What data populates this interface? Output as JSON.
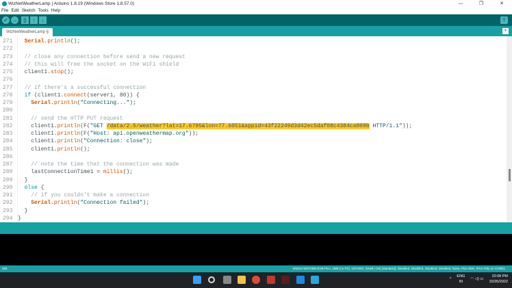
{
  "window": {
    "title": "WizNetWeatherLamp | Arduino 1.8.19 (Windows Store 1.8.57.0)",
    "controls": [
      "—",
      "❐",
      "✕"
    ]
  },
  "menu": [
    "File",
    "Edit",
    "Sketch",
    "Tools",
    "Help"
  ],
  "toolbar": {
    "verify": "✓",
    "upload": "→",
    "new": "▯",
    "open": "↑",
    "save": "↓",
    "serial_monitor": "⚲"
  },
  "tab": {
    "label": "WizNetWeatherLamp §",
    "menu": "▾"
  },
  "code": [
    {
      "n": "271",
      "s": [
        [
          "  ",
          ""
        ],
        [
          "Serial",
          "cl"
        ],
        [
          ".",
          ""
        ],
        [
          "println",
          "fn"
        ],
        [
          "();",
          ""
        ]
      ]
    },
    {
      "n": "272",
      "s": []
    },
    {
      "n": "273",
      "s": [
        [
          "  // close any connection before send a new request",
          "cm"
        ]
      ]
    },
    {
      "n": "274",
      "s": [
        [
          "  // this will free the socket on the WiFi shield",
          "cm"
        ]
      ]
    },
    {
      "n": "275",
      "s": [
        [
          "  client1.",
          ""
        ],
        [
          "stop",
          "fn"
        ],
        [
          "();",
          ""
        ]
      ]
    },
    {
      "n": "276",
      "s": []
    },
    {
      "n": "277",
      "s": [
        [
          "  // if there's a successful connection",
          "cm"
        ]
      ]
    },
    {
      "n": "278",
      "s": [
        [
          "  ",
          ""
        ],
        [
          "if",
          "kw"
        ],
        [
          " (client1.",
          ""
        ],
        [
          "connect",
          "fn"
        ],
        [
          "(server1, 80)) {",
          ""
        ]
      ]
    },
    {
      "n": "279",
      "s": [
        [
          "    ",
          ""
        ],
        [
          "Serial",
          "cl"
        ],
        [
          ".",
          ""
        ],
        [
          "println",
          "fn"
        ],
        [
          "(",
          ""
        ],
        [
          "\"Connecting...\"",
          "st"
        ],
        [
          ");",
          ""
        ]
      ]
    },
    {
      "n": "280",
      "s": []
    },
    {
      "n": "281",
      "s": [
        [
          "    // send the HTTP PUT request",
          "cm"
        ]
      ]
    },
    {
      "n": "282",
      "s": [
        [
          "    client1.",
          ""
        ],
        [
          "println",
          "fn"
        ],
        [
          "(F(",
          ""
        ],
        [
          "\"GET ",
          "st"
        ],
        [
          "/data/2.5/weather?lat=17.6795&lon=77.6051&appid=43f22249d3d42ec5daf08c4384ca809b",
          "hl"
        ],
        [
          " HTTP/1.1\"",
          "st"
        ],
        [
          "));",
          ""
        ]
      ]
    },
    {
      "n": "283",
      "s": [
        [
          "    client1.",
          ""
        ],
        [
          "println",
          "fn"
        ],
        [
          "(F(",
          ""
        ],
        [
          "\"Host: api.openweathermap.org\"",
          "st"
        ],
        [
          "));",
          ""
        ]
      ]
    },
    {
      "n": "284",
      "s": [
        [
          "    client1.",
          ""
        ],
        [
          "println",
          "fn"
        ],
        [
          "(",
          ""
        ],
        [
          "\"Connection: close\"",
          "st"
        ],
        [
          ");",
          ""
        ]
      ]
    },
    {
      "n": "285",
      "s": [
        [
          "    client1.",
          ""
        ],
        [
          "println",
          "fn"
        ],
        [
          "();",
          ""
        ]
      ]
    },
    {
      "n": "286",
      "s": []
    },
    {
      "n": "287",
      "s": [
        [
          "    // note the time that the connection was made",
          "cm"
        ]
      ]
    },
    {
      "n": "288",
      "s": [
        [
          "    lastConnectionTime1 = ",
          ""
        ],
        [
          "millis",
          "fn"
        ],
        [
          "();",
          ""
        ]
      ]
    },
    {
      "n": "289",
      "s": [
        [
          "  }",
          ""
        ]
      ]
    },
    {
      "n": "290",
      "s": [
        [
          "  ",
          ""
        ],
        [
          "else",
          "kw"
        ],
        [
          " {",
          ""
        ]
      ]
    },
    {
      "n": "291",
      "s": [
        [
          "    // if you couldn't make a connection",
          "cm"
        ]
      ]
    },
    {
      "n": "292",
      "s": [
        [
          "    ",
          ""
        ],
        [
          "Serial",
          "cl"
        ],
        [
          ".",
          ""
        ],
        [
          "println",
          "fn"
        ],
        [
          "(",
          ""
        ],
        [
          "\"Connection failed\"",
          "st"
        ],
        [
          ");",
          ""
        ]
      ]
    },
    {
      "n": "293",
      "s": [
        [
          "  }",
          ""
        ]
      ]
    },
    {
      "n": "294",
      "s": [
        [
          "}",
          ""
        ]
      ]
    }
  ],
  "status": {
    "line": "282",
    "board": "WIZnet WizFi360-EVB-Pico, 2MB (no FS), 133 MHz, Small (-Os) (standard), Disabled, Disabled, Disabled, Disabled, None, Pico SDK, IPv4 Only on COM11"
  },
  "tray": {
    "lang1": "ENG",
    "lang2": "IN",
    "time": "10:08 PM",
    "date": "10/26/2022",
    "chevron": "^",
    "icons": "◠ ◁) ▭"
  }
}
